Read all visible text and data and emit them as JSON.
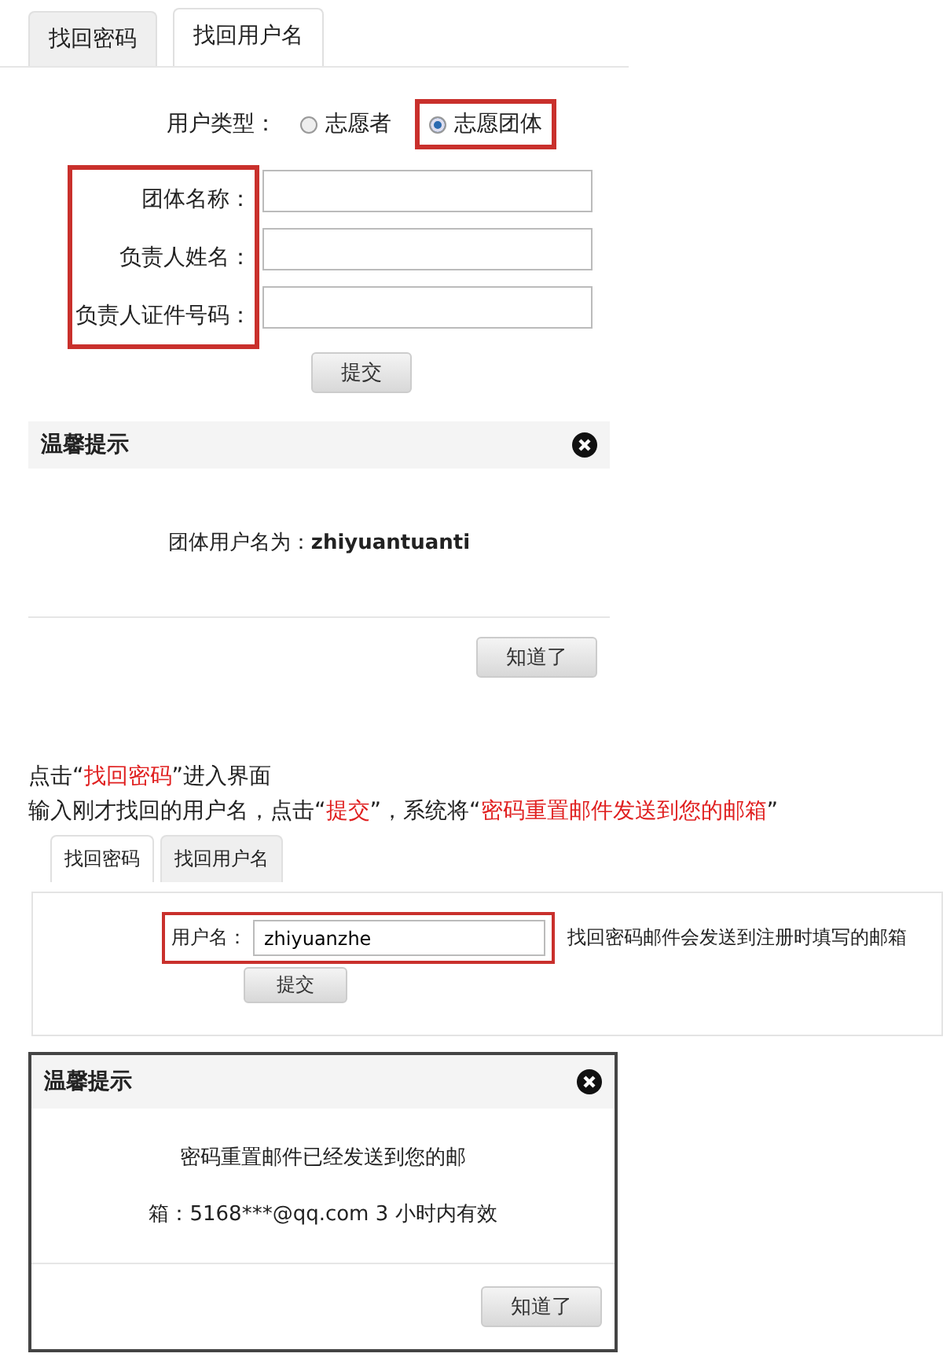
{
  "panel_1": {
    "tabs": [
      {
        "label": "找回密码",
        "selected": false
      },
      {
        "label": "找回用户名",
        "selected": true
      }
    ],
    "user_type": {
      "label": "用户类型：",
      "options": [
        {
          "label": "志愿者",
          "selected": false,
          "boxed": false
        },
        {
          "label": "志愿团体",
          "selected": true,
          "boxed": true
        }
      ]
    },
    "labels_boxed": true,
    "fields": [
      {
        "label": "团体名称："
      },
      {
        "label": "负责人姓名："
      },
      {
        "label": "负责人证件号码："
      }
    ],
    "submit": "提交"
  },
  "dialog_1": {
    "title": "温馨提示",
    "lines": [
      {
        "prefix": "团体用户名为：",
        "value": "zhiyuantuanti"
      }
    ],
    "button": "知道了",
    "bordered": false
  },
  "instructions": [
    [
      {
        "text": "点击“",
        "highlight": false
      },
      {
        "text": "找回密码",
        "highlight": true
      },
      {
        "text": "”进入界面",
        "highlight": false
      }
    ],
    [
      {
        "text": "输入刚才找回的用户名，点击“",
        "highlight": false
      },
      {
        "text": "提交",
        "highlight": true
      },
      {
        "text": "”，系统将“",
        "highlight": false
      },
      {
        "text": "密码重置邮件发送到您的邮箱",
        "highlight": true
      },
      {
        "text": "”",
        "highlight": false
      }
    ]
  ],
  "panel_2": {
    "tabs": [
      {
        "label": "找回密码",
        "selected": true
      },
      {
        "label": "找回用户名",
        "selected": false
      }
    ],
    "field": {
      "label": "用户名：",
      "value": "zhiyuanzhe",
      "boxed": true
    },
    "hint": "找回密码邮件会发送到注册时填写的邮箱",
    "submit": "提交"
  },
  "dialog_2": {
    "title": "温馨提示",
    "lines": [
      {
        "prefix": "密码重置邮件已经发送到您的邮"
      },
      {
        "prefix": "箱：5168***@qq.com 3 小时内有效"
      }
    ],
    "button": "知道了",
    "bordered": true
  }
}
